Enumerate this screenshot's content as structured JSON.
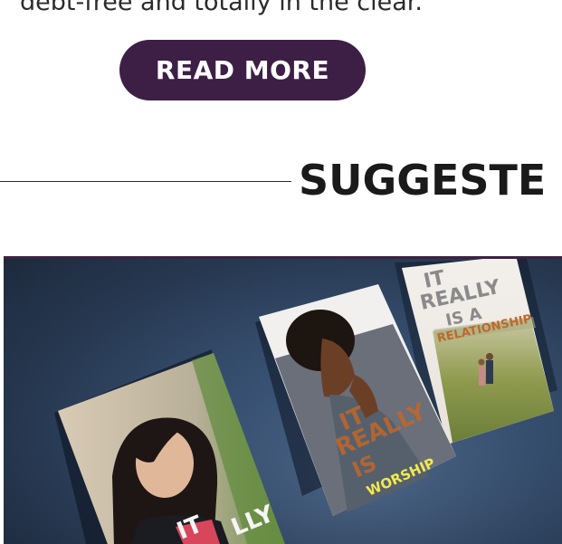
{
  "intro": {
    "text": "debt-free and totally in the clear."
  },
  "cta": {
    "label": "READ MORE"
  },
  "section": {
    "heading": "SUGGESTE"
  },
  "books": [
    {
      "line1": "IT",
      "line2": "REALLY",
      "line3": "IS A",
      "line4": "RELATIONSHIP"
    },
    {
      "line1": "IT",
      "line2": "REALLY",
      "line3": "IS",
      "line4": "WORSHIP"
    },
    {
      "line1": "IT",
      "line2": "LLY"
    }
  ],
  "colors": {
    "button_bg": "#3d1f45",
    "hero_border": "#3a2340",
    "worship_accent": "#f2e94e",
    "title_orange": "#c1672a"
  }
}
